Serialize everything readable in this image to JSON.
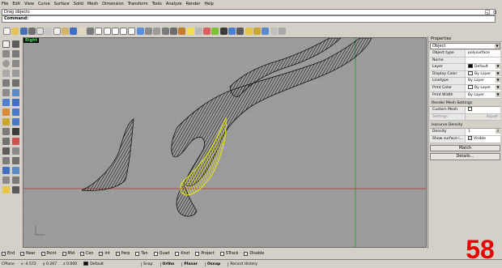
{
  "menu": [
    "File",
    "Edit",
    "View",
    "Curve",
    "Surface",
    "Solid",
    "Mesh",
    "Dimension",
    "Transform",
    "Tools",
    "Analyze",
    "Render",
    "Help"
  ],
  "command": {
    "history": "Drag objects",
    "prompt": "Command:"
  },
  "viewport": {
    "title": "Right"
  },
  "properties": {
    "title": "Properties",
    "selected": "Object",
    "rows": [
      {
        "k": "Object type",
        "v": "polysurface"
      },
      {
        "k": "Name",
        "v": ""
      },
      {
        "k": "Layer",
        "v": "Default"
      },
      {
        "k": "Display Color",
        "v": "By Layer"
      },
      {
        "k": "Linetype",
        "v": "By Layer"
      },
      {
        "k": "Print Color",
        "v": "By Layer"
      },
      {
        "k": "Print Width",
        "v": "By Layer"
      }
    ],
    "render_mesh": {
      "section": "Render Mesh Settings",
      "custom_label": "Custom Mesh",
      "settings_label": "Settings",
      "adjust_label": "Adjust"
    },
    "isocurve": {
      "section": "Isocurve Density",
      "density_label": "Density",
      "density_value": "1",
      "show_label": "Show surface i...",
      "visible_label": "Visible"
    },
    "match_label": "Match",
    "details_label": "Details..."
  },
  "osnap": [
    "End",
    "Near",
    "Point",
    "Mid",
    "Cen",
    "Int",
    "Perp",
    "Tan",
    "Quad",
    "Knot",
    "Project",
    "STrack",
    "Disable"
  ],
  "status": {
    "cplane": "CPlane",
    "x": "x -4.572",
    "y": "y 0.267",
    "z": "z 0.000",
    "layer": "Default",
    "snap": "Snap",
    "ortho": "Ortho",
    "planar": "Planar",
    "osnap": "Osnap",
    "history": "Record History"
  },
  "overlay_number": "58",
  "colors": {
    "selection": "#f0f000",
    "wire": "#000000",
    "overlay": "#e60000",
    "viewport_bg": "#9b9b9b"
  }
}
